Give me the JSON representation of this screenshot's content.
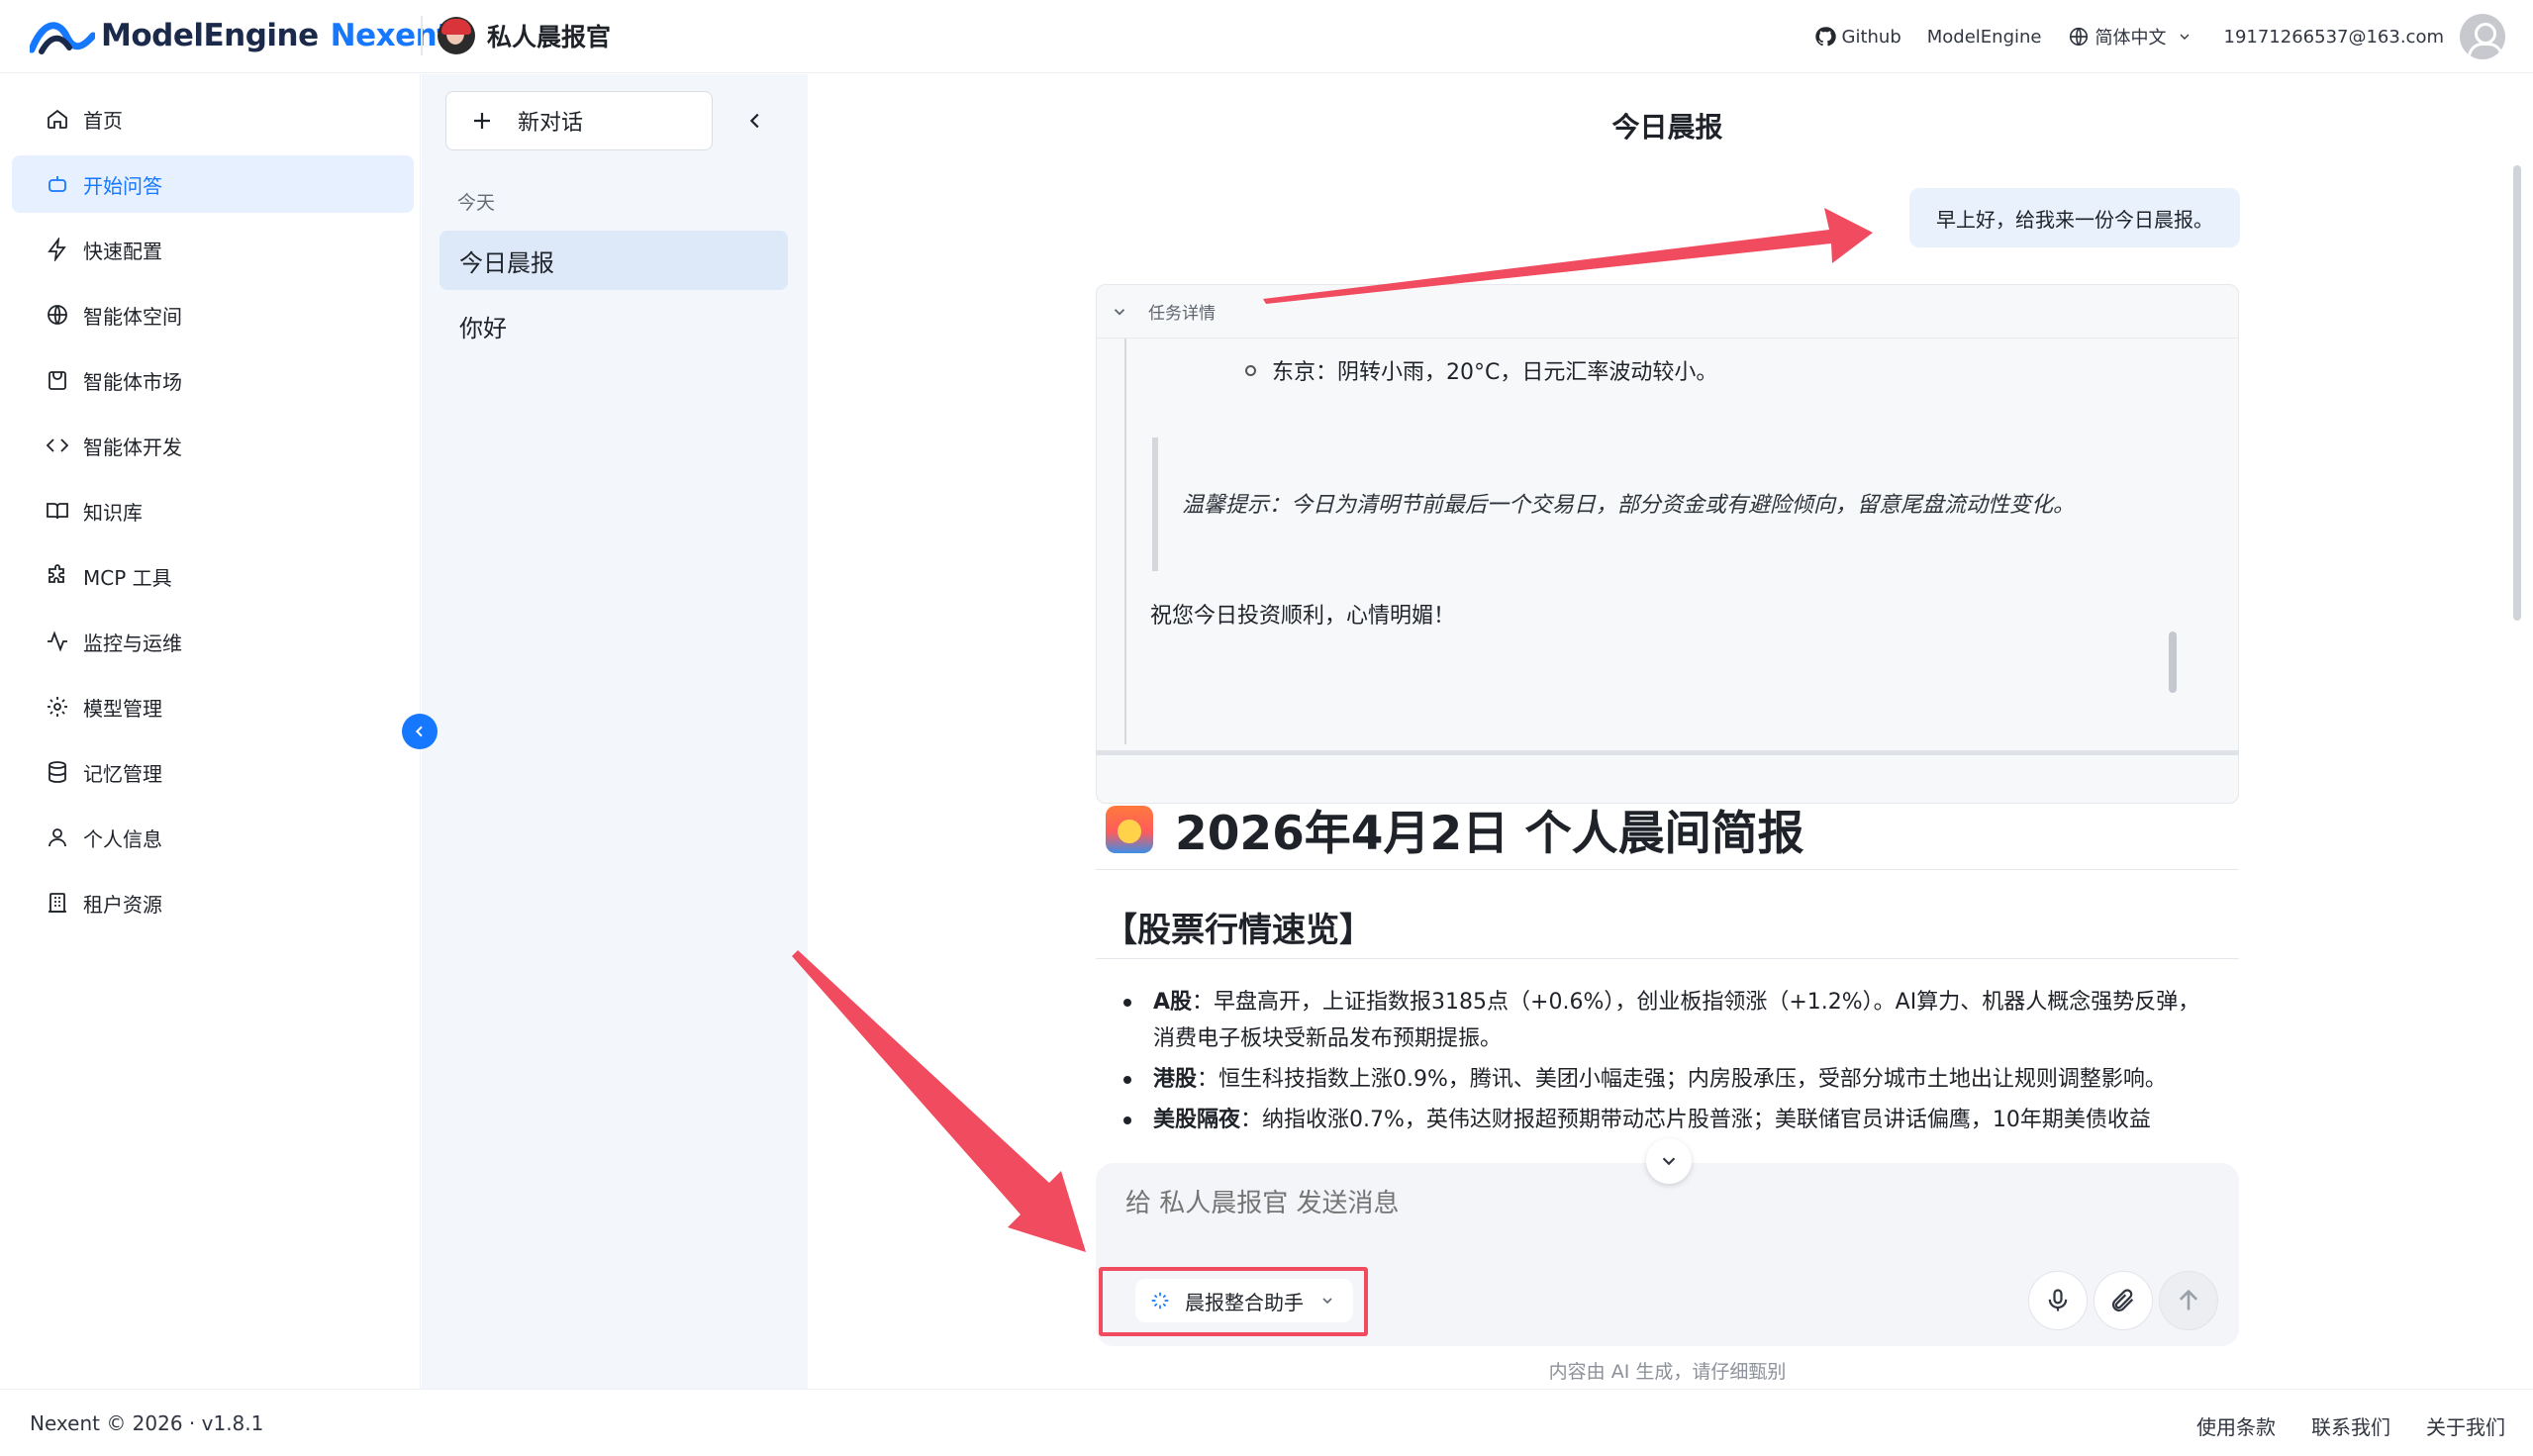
{
  "header": {
    "brand_name": "ModelEngine",
    "brand_accent": "Nexent",
    "agent_name": "私人晨报官",
    "github_label": "Github",
    "modelengine_label": "ModelEngine",
    "language_label": "简体中文",
    "user_email": "19171266537@163.com"
  },
  "sidebar": {
    "items": [
      {
        "label": "首页",
        "icon": "home-icon"
      },
      {
        "label": "开始问答",
        "icon": "robot-icon",
        "active": true
      },
      {
        "label": "快速配置",
        "icon": "bolt-icon"
      },
      {
        "label": "智能体空间",
        "icon": "globe-icon"
      },
      {
        "label": "智能体市场",
        "icon": "shopping-bag-icon"
      },
      {
        "label": "智能体开发",
        "icon": "code-icon"
      },
      {
        "label": "知识库",
        "icon": "book-icon"
      },
      {
        "label": "MCP 工具",
        "icon": "puzzle-icon"
      },
      {
        "label": "监控与运维",
        "icon": "activity-icon"
      },
      {
        "label": "模型管理",
        "icon": "gear-icon"
      },
      {
        "label": "记忆管理",
        "icon": "database-icon"
      },
      {
        "label": "个人信息",
        "icon": "user-icon"
      },
      {
        "label": "租户资源",
        "icon": "building-icon"
      }
    ]
  },
  "conversations": {
    "new_chat_label": "新对话",
    "group_label": "今天",
    "items": [
      {
        "title": "今日晨报",
        "active": true
      },
      {
        "title": "你好"
      }
    ]
  },
  "chat": {
    "title": "今日晨报",
    "user_message": "早上好，给我来一份今日晨报。",
    "task_details_label": "任务详情",
    "task_bullet": "东京：阴转小雨，20°C，日元汇率波动较小。",
    "task_quote": "温馨提示：今日为清明节前最后一个交易日，部分资金或有避险倾向，留意尾盘流动性变化。",
    "task_closing": "祝您今日投资顺利，心情明媚！",
    "report_title": "2026年4月2日 个人晨间简报",
    "section_title": "【股票行情速览】",
    "bullets": [
      {
        "label": "A股",
        "text": "：早盘高开，上证指数报3185点（+0.6%），创业板指领涨（+1.2%）。AI算力、机器人概念强势反弹，消费电子板块受新品发布预期提振。"
      },
      {
        "label": "港股",
        "text": "：恒生科技指数上涨0.9%，腾讯、美团小幅走强；内房股承压，受部分城市土地出让规则调整影响。"
      },
      {
        "label": "美股隔夜",
        "text": "：纳指收涨0.7%，英伟达财报超预期带动芯片股普涨；美联储官员讲话偏鹰，10年期美债收益"
      }
    ],
    "input_placeholder": "给 私人晨报官 发送消息",
    "agent_selector_label": "晨报整合助手",
    "disclaimer": "内容由 AI 生成，请仔细甄别"
  },
  "footer": {
    "copyright": "Nexent © 2026 · v1.8.1",
    "links": [
      "使用条款",
      "联系我们",
      "关于我们"
    ]
  },
  "colors": {
    "accent": "#1677ff",
    "active_bg": "#e6f0ff",
    "annotation": "#f04b5e"
  }
}
